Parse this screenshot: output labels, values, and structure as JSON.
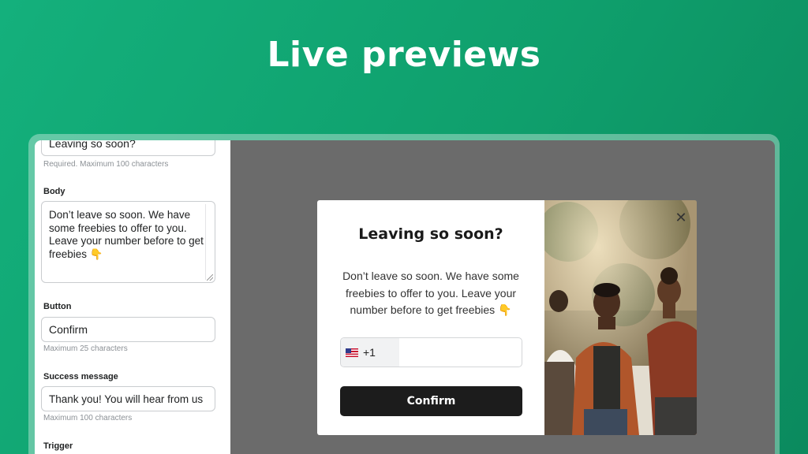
{
  "hero": {
    "title": "Live previews"
  },
  "editor": {
    "title_field": {
      "value": "Leaving so soon?",
      "help": "Required. Maximum 100 characters"
    },
    "body_field": {
      "label": "Body",
      "value": "Don’t leave so soon. We have some freebies to offer to you. Leave your number before to get freebies 👇"
    },
    "button_field": {
      "label": "Button",
      "value": "Confirm",
      "help": "Maximum 25 characters"
    },
    "success_field": {
      "label": "Success message",
      "value": "Thank you! You will hear from us",
      "help": "Maximum 100 characters"
    },
    "trigger_field": {
      "label": "Trigger"
    }
  },
  "popup": {
    "title": "Leaving so soon?",
    "body": "Don’t leave so soon. We have some freebies to offer to you. Leave your number before to get freebies 👇",
    "phone": {
      "country_icon": "us-flag-icon",
      "dial_code": "+1",
      "value": ""
    },
    "confirm_label": "Confirm",
    "close_icon": "close-icon",
    "close_glyph": "✕"
  },
  "colors": {
    "brand_green": "#12a874",
    "preview_background": "#6b6b6b",
    "confirm_button": "#1c1c1c"
  }
}
